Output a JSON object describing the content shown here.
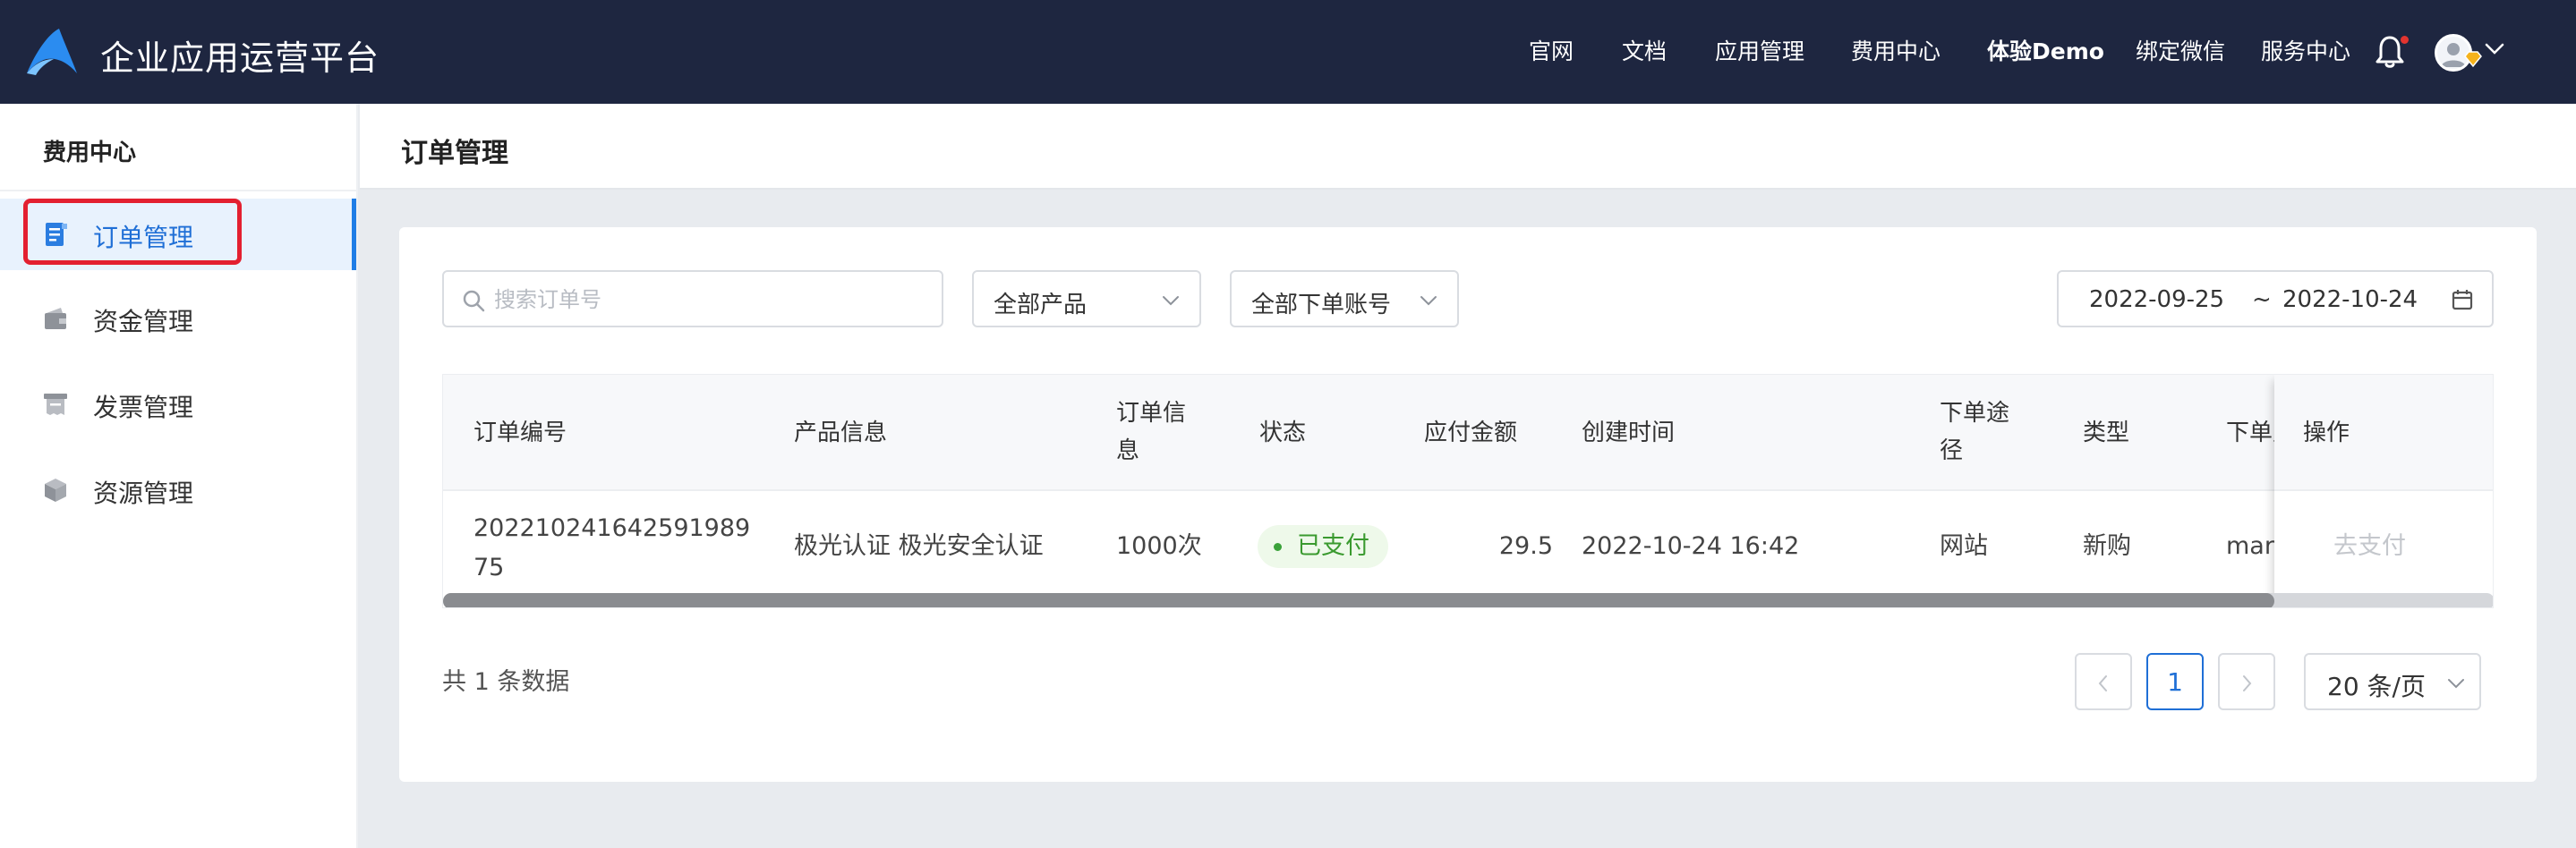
{
  "app": {
    "title": "企业应用运营平台"
  },
  "topnav": {
    "items": [
      {
        "label": "官网"
      },
      {
        "label": "文档"
      },
      {
        "label": "应用管理"
      },
      {
        "label": "费用中心"
      },
      {
        "label": "体验Demo"
      },
      {
        "label": "绑定微信"
      },
      {
        "label": "服务中心"
      }
    ]
  },
  "sidebar": {
    "title": "费用中心",
    "items": [
      {
        "label": "订单管理",
        "icon": "order-icon",
        "active": true
      },
      {
        "label": "资金管理",
        "icon": "wallet-icon"
      },
      {
        "label": "发票管理",
        "icon": "invoice-icon"
      },
      {
        "label": "资源管理",
        "icon": "cube-icon"
      }
    ]
  },
  "page": {
    "title": "订单管理"
  },
  "filters": {
    "search_placeholder": "搜索订单号",
    "product_select": "全部产品",
    "account_select": "全部下单账号",
    "date_start": "2022-09-25",
    "date_separator": "~",
    "date_end": "2022-10-24"
  },
  "table": {
    "columns": {
      "order_id": "订单编号",
      "product": "产品信息",
      "order_info_1": "订单信",
      "order_info_2": "息",
      "status": "状态",
      "amount": "应付金额",
      "created": "创建时间",
      "channel_1": "下单途",
      "channel_2": "径",
      "type": "类型",
      "account": "下单账号",
      "action": "操作"
    },
    "rows": [
      {
        "order_id_1": "202210241642591989",
        "order_id_2": "75",
        "product": "极光认证 极光安全认证",
        "order_info": "1000次",
        "status": "已支付",
        "amount": "29.5",
        "created": "2022-10-24 16:42",
        "channel": "网站",
        "type": "新购",
        "account": "mars",
        "action": "去支付"
      }
    ]
  },
  "pagination": {
    "total_text": "共 1 条数据",
    "current_page": "1",
    "page_size": "20 条/页"
  },
  "colors": {
    "topbar": "#1e2640",
    "accent": "#1f6fd6",
    "status_green": "#3a9a2f",
    "highlight": "#e32030"
  }
}
